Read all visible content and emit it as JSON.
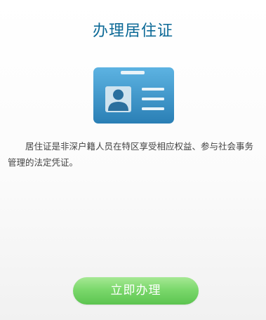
{
  "page": {
    "title": "办理居住证",
    "description": "居住证是非深户籍人员在特区享受相应权益、参与社会事务管理的法定凭证。",
    "action_button_label": "立即办理",
    "icon": "id-card-icon",
    "colors": {
      "title": "#0d6a97",
      "card_blue": "#3e97c9",
      "button_green": "#7bd86c"
    }
  }
}
